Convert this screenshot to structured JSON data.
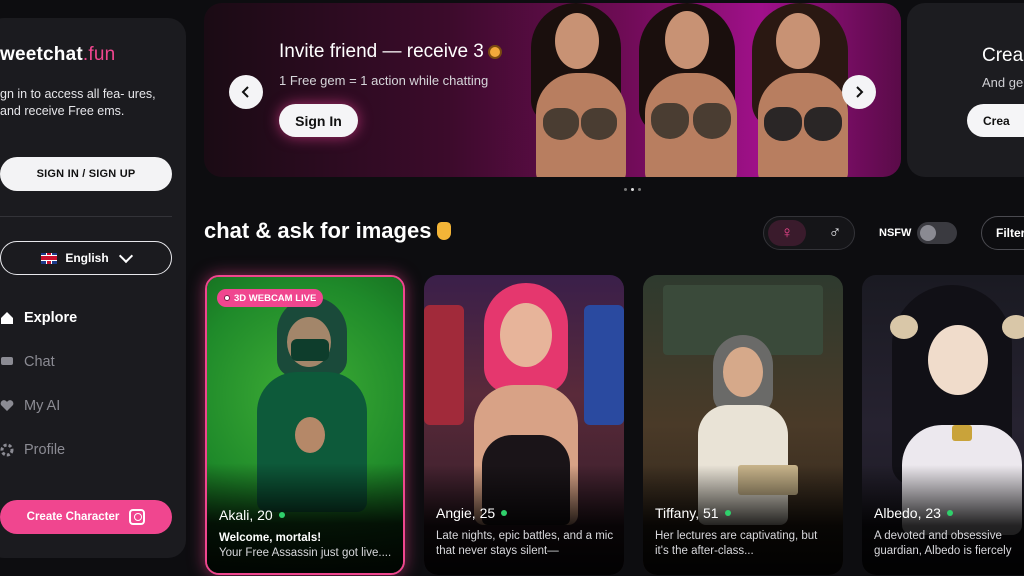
{
  "sidebar": {
    "brand_main": "weetchat",
    "brand_accent": ".fun",
    "promo_text": "gn in to access all fea- ures, and receive Free ems.",
    "signin_label": "SIGN IN / SIGN UP",
    "language": "English",
    "nav": [
      {
        "label": "Explore",
        "icon": "home-icon",
        "active": true
      },
      {
        "label": "Chat",
        "icon": "chat-icon",
        "active": false
      },
      {
        "label": "My AI",
        "icon": "heart-icon",
        "active": false
      },
      {
        "label": "Profile",
        "icon": "gear-icon",
        "active": false
      }
    ],
    "create_label": "Create Character"
  },
  "banner": {
    "title": "Invite friend — receive 3",
    "subtitle": "1 Free gem = 1 action while chatting",
    "button": "Sign In",
    "prev": "‹",
    "next": "›"
  },
  "banner2": {
    "title": "Crea",
    "subtitle": "And ge",
    "button": "Crea"
  },
  "section": {
    "title": "chat & ask for images",
    "female_symbol": "♀",
    "male_symbol": "♂",
    "nsfw_label": "NSFW",
    "filter_label": "Filter"
  },
  "cards": [
    {
      "name": "Akali, 20",
      "badge": "3D WEBCAM LIVE",
      "desc_bold": "Welcome, mortals!",
      "desc": "Your Free Assassin just got live...."
    },
    {
      "name": "Angie, 25",
      "desc": "Late nights, epic battles, and a mic that never stays silent—"
    },
    {
      "name": "Tiffany, 51",
      "desc": "Her lectures are captivating, but it's the after-class..."
    },
    {
      "name": "Albedo, 23",
      "desc": "A devoted and obsessive guardian, Albedo is fiercely"
    }
  ],
  "colors": {
    "accent": "#f0468f",
    "online": "#2fd06b"
  }
}
